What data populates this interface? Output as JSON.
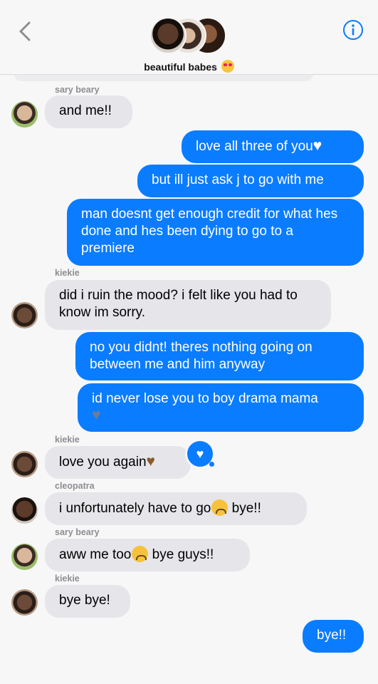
{
  "header": {
    "group_name": "beautiful babes",
    "group_emoji": "smiling-face-with-heart-eyes"
  },
  "icons": {
    "back": "chevron-left-icon",
    "info": "info-icon",
    "reaction": "heart-tapback-icon"
  },
  "colors": {
    "outgoing_bubble": "#0a7cff",
    "incoming_bubble": "#e5e5ea",
    "background": "#f7f7f7",
    "sender_label": "#8e8e93"
  },
  "messages": [
    {
      "sender": "sary beary",
      "text": "and me!!",
      "emoji": ""
    },
    {
      "sender": "me",
      "text": "love all three of you",
      "emoji": "white-heart"
    },
    {
      "sender": "me",
      "text": "but ill just ask j to go with me",
      "emoji": ""
    },
    {
      "sender": "me",
      "text": "man doesnt get enough credit for what hes done and hes been dying to go to a premiere",
      "emoji": ""
    },
    {
      "sender": "kiekie",
      "text": "did i ruin the mood? i felt like you had to know im sorry.",
      "emoji": ""
    },
    {
      "sender": "me",
      "text": "no you didnt! theres nothing going on between me and him anyway",
      "emoji": ""
    },
    {
      "sender": "me",
      "text": "id never lose you to boy drama mama",
      "emoji": "grey-heart"
    },
    {
      "sender": "kiekie",
      "text": "love you again",
      "emoji": "brown-heart"
    },
    {
      "sender": "cleopatra",
      "text_before": "i unfortunately have to go",
      "text_after": " bye!!",
      "emoji": "frowning-face"
    },
    {
      "sender": "sary beary",
      "text_before": "aww me too",
      "text_after": " bye guys!!",
      "emoji": "slightly-frowning-face"
    },
    {
      "sender": "kiekie",
      "text": "bye bye!",
      "emoji": ""
    },
    {
      "sender": "me",
      "text": "bye!!",
      "emoji": ""
    }
  ]
}
